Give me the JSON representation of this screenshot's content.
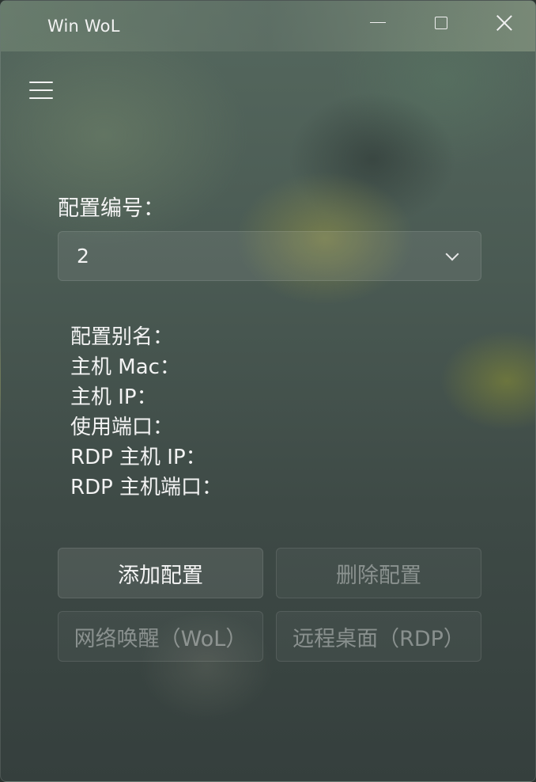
{
  "window": {
    "title": "Win WoL",
    "controls": {
      "minimize": "minimize",
      "maximize": "maximize",
      "close": "close"
    }
  },
  "nav": {
    "menu_icon": "hamburger-menu-icon"
  },
  "config": {
    "label": "配置编号：",
    "selected": "2"
  },
  "details": {
    "alias": "配置别名：",
    "mac": "主机 Mac：",
    "ip": "主机 IP：",
    "port": "使用端口：",
    "rdp_ip": "RDP 主机 IP：",
    "rdp_port": "RDP 主机端口："
  },
  "buttons": {
    "add": {
      "label": "添加配置",
      "enabled": true
    },
    "delete": {
      "label": "删除配置",
      "enabled": false
    },
    "wol": {
      "label": "网络唤醒（WoL）",
      "enabled": false
    },
    "rdp": {
      "label": "远程桌面（RDP）",
      "enabled": false
    }
  }
}
